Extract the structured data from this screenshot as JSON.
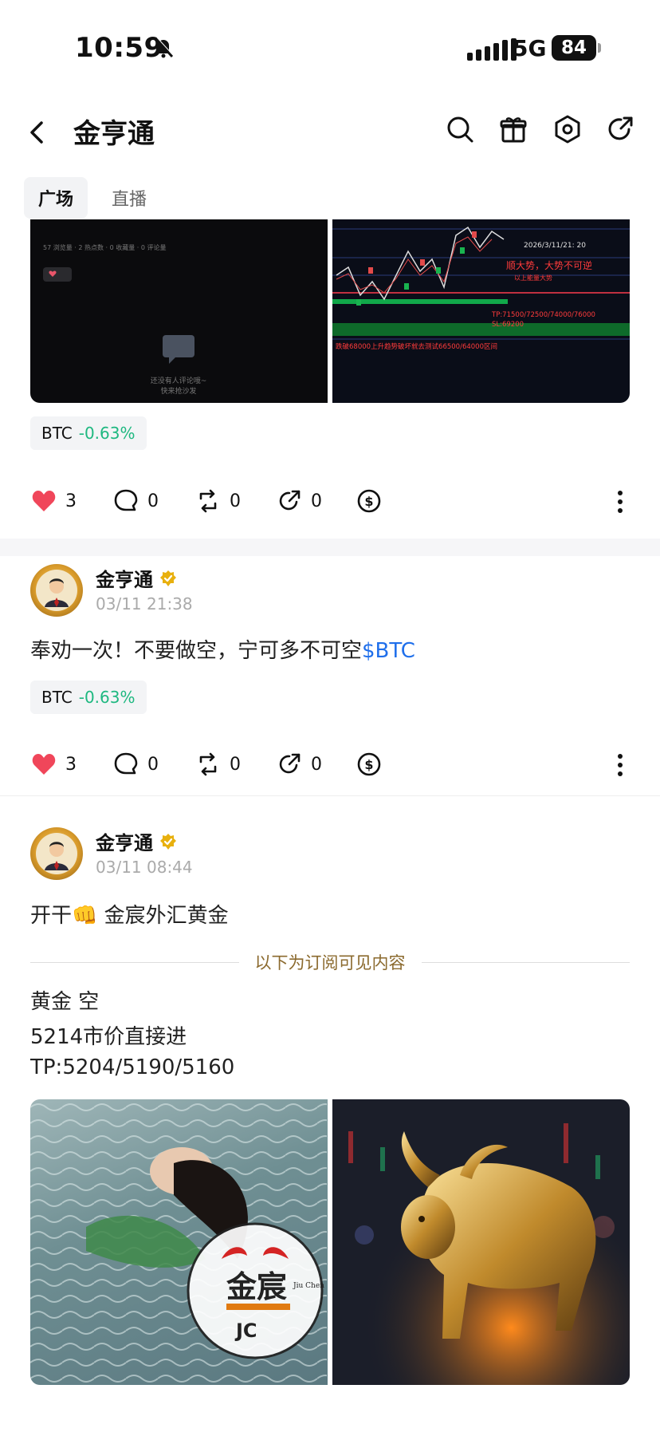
{
  "status": {
    "time": "10:59",
    "network": "5G",
    "battery": "84"
  },
  "header": {
    "title": "金亨通"
  },
  "tabs": [
    {
      "label": "广场"
    },
    {
      "label": "直播"
    }
  ],
  "posts": [
    {
      "ticker": {
        "symbol": "BTC",
        "change": "-0.63%"
      },
      "stats": {
        "likes": "3",
        "comments": "0",
        "reposts": "0",
        "shares": "0"
      },
      "image_text": {
        "chart_date": "2026/3/11/21: 20",
        "headline": "顺大势，大势不可逆",
        "sub": "以上能量大势",
        "tp": "TP:71500/72500/74000/76000",
        "sl": "SL:69200",
        "note": "跌破68000上升趋势破坏就去测试66500/64000区间",
        "empty_comment": "还没有人评论哦~",
        "empty_comment2": "快来抢沙发"
      }
    },
    {
      "author": "金亨通",
      "date": "03/11 21:38",
      "text": "奉劝一次！不要做空，宁可多不可空",
      "link": "$BTC",
      "ticker": {
        "symbol": "BTC",
        "change": "-0.63%"
      },
      "stats": {
        "likes": "3",
        "comments": "0",
        "reposts": "0",
        "shares": "0"
      }
    },
    {
      "author": "金亨通",
      "date": "03/11 08:44",
      "text_prefix": "开干",
      "emoji": "👊",
      "text_suffix": " 金宸外汇黄金",
      "subscribe_divider": "以下为订阅可见内容",
      "lines": [
        "黄金  空",
        "5214市价直接进",
        "TP:5204/5190/5160"
      ],
      "logo": {
        "main": "金宸",
        "latin": "Jiu Chen",
        "short": "JC"
      }
    }
  ],
  "colors": {
    "positive": "#1eb880",
    "link": "#1f6feb",
    "like": "#f0465a",
    "gold": "#e8b00e"
  }
}
